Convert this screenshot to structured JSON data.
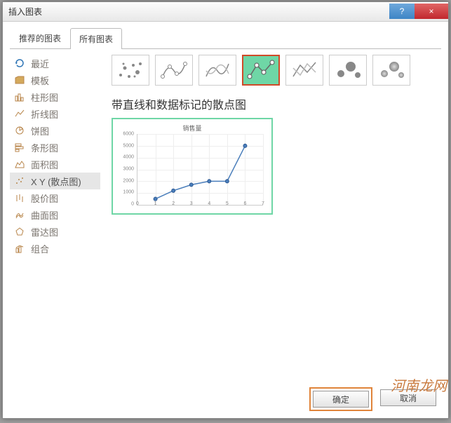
{
  "window": {
    "title": "插入图表",
    "help_label": "?",
    "close_label": "×"
  },
  "tabs": {
    "recommended": "推荐的图表",
    "all": "所有图表"
  },
  "sidebar": {
    "items": [
      {
        "label": "最近",
        "icon": "recent-icon"
      },
      {
        "label": "模板",
        "icon": "template-icon"
      },
      {
        "label": "柱形图",
        "icon": "column-icon"
      },
      {
        "label": "折线图",
        "icon": "line-icon"
      },
      {
        "label": "饼图",
        "icon": "pie-icon"
      },
      {
        "label": "条形图",
        "icon": "bar-icon"
      },
      {
        "label": "面积图",
        "icon": "area-icon"
      },
      {
        "label": "X Y (散点图)",
        "icon": "scatter-icon"
      },
      {
        "label": "股价图",
        "icon": "stock-icon"
      },
      {
        "label": "曲面图",
        "icon": "surface-icon"
      },
      {
        "label": "雷达图",
        "icon": "radar-icon"
      },
      {
        "label": "组合",
        "icon": "combo-icon"
      }
    ],
    "selected_index": 7
  },
  "subtypes": {
    "selected_index": 3,
    "title": "带直线和数据标记的散点图"
  },
  "preview": {
    "title": "销售量"
  },
  "chart_data": {
    "type": "line",
    "title": "销售量",
    "xlabel": "",
    "ylabel": "",
    "xlim": [
      0,
      7
    ],
    "ylim": [
      0,
      6000
    ],
    "x_ticks": [
      0,
      1,
      2,
      3,
      4,
      5,
      6,
      7
    ],
    "y_ticks": [
      0,
      1000,
      2000,
      3000,
      4000,
      5000,
      6000
    ],
    "x": [
      1,
      2,
      3,
      4,
      5,
      6
    ],
    "values": [
      500,
      1200,
      1700,
      2000,
      2000,
      5000
    ],
    "markers": true
  },
  "footer": {
    "ok": "确定",
    "cancel": "取消"
  },
  "watermark": "河南龙网"
}
